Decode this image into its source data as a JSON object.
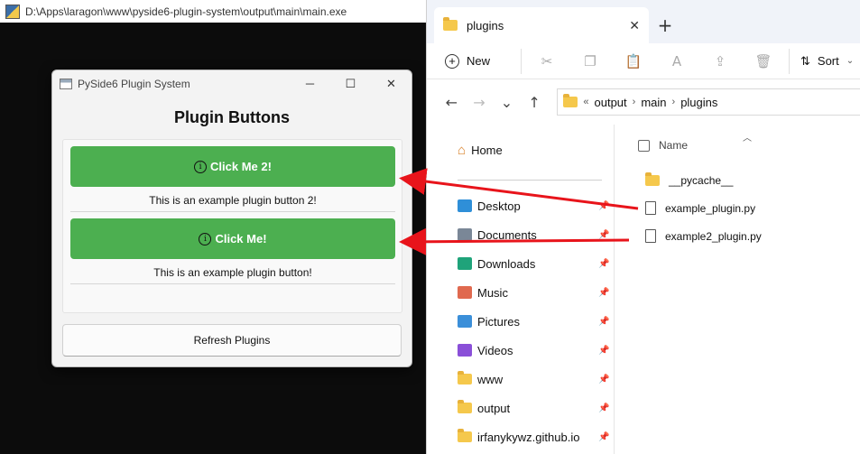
{
  "console": {
    "title": "D:\\Apps\\laragon\\www\\pyside6-plugin-system\\output\\main\\main.exe"
  },
  "qt_window": {
    "title": "PySide6 Plugin System",
    "controls": {
      "minimize": "─",
      "maximize": "☐",
      "close": "✕"
    },
    "heading": "Plugin Buttons",
    "plugins": [
      {
        "button_label": "Click Me 2!",
        "description": "This is an example plugin button 2!"
      },
      {
        "button_label": "Click Me!",
        "description": "This is an example plugin button!"
      }
    ],
    "info_glyph": "i",
    "refresh_label": "Refresh Plugins",
    "colors": {
      "plugin_button": "#4caf50"
    }
  },
  "explorer": {
    "tab_title": "plugins",
    "tab_close": "✕",
    "new_tab": "+",
    "toolbar": {
      "new_label": "New",
      "sort_label": "Sort"
    },
    "nav_glyphs": {
      "back": "←",
      "forward": "→",
      "down": "⌄",
      "up": "↑"
    },
    "address": {
      "prefix": "«",
      "parts": [
        "output",
        "main",
        "plugins"
      ],
      "separator": "›"
    },
    "sidebar": {
      "home": "Home",
      "items": [
        {
          "label": "Desktop",
          "icon": "desktop-icon",
          "color": "#2f8fd8"
        },
        {
          "label": "Documents",
          "icon": "documents-icon",
          "color": "#7a8797"
        },
        {
          "label": "Downloads",
          "icon": "downloads-icon",
          "color": "#1fa37a"
        },
        {
          "label": "Music",
          "icon": "music-icon",
          "color": "#e0694f"
        },
        {
          "label": "Pictures",
          "icon": "pictures-icon",
          "color": "#3b8fd9"
        },
        {
          "label": "Videos",
          "icon": "videos-icon",
          "color": "#8a4fd8"
        },
        {
          "label": "www",
          "icon": "folder-icon",
          "color": "#f5c84c"
        },
        {
          "label": "output",
          "icon": "folder-icon",
          "color": "#f5c84c"
        },
        {
          "label": "irfanykywz.github.io",
          "icon": "folder-icon",
          "color": "#f5c84c"
        }
      ]
    },
    "files": {
      "column_name": "Name",
      "items": [
        {
          "name": "__pycache__",
          "type": "folder"
        },
        {
          "name": "example_plugin.py",
          "type": "file"
        },
        {
          "name": "example2_plugin.py",
          "type": "file"
        }
      ]
    }
  },
  "annotation": {
    "arrow_color": "#e8141b"
  }
}
